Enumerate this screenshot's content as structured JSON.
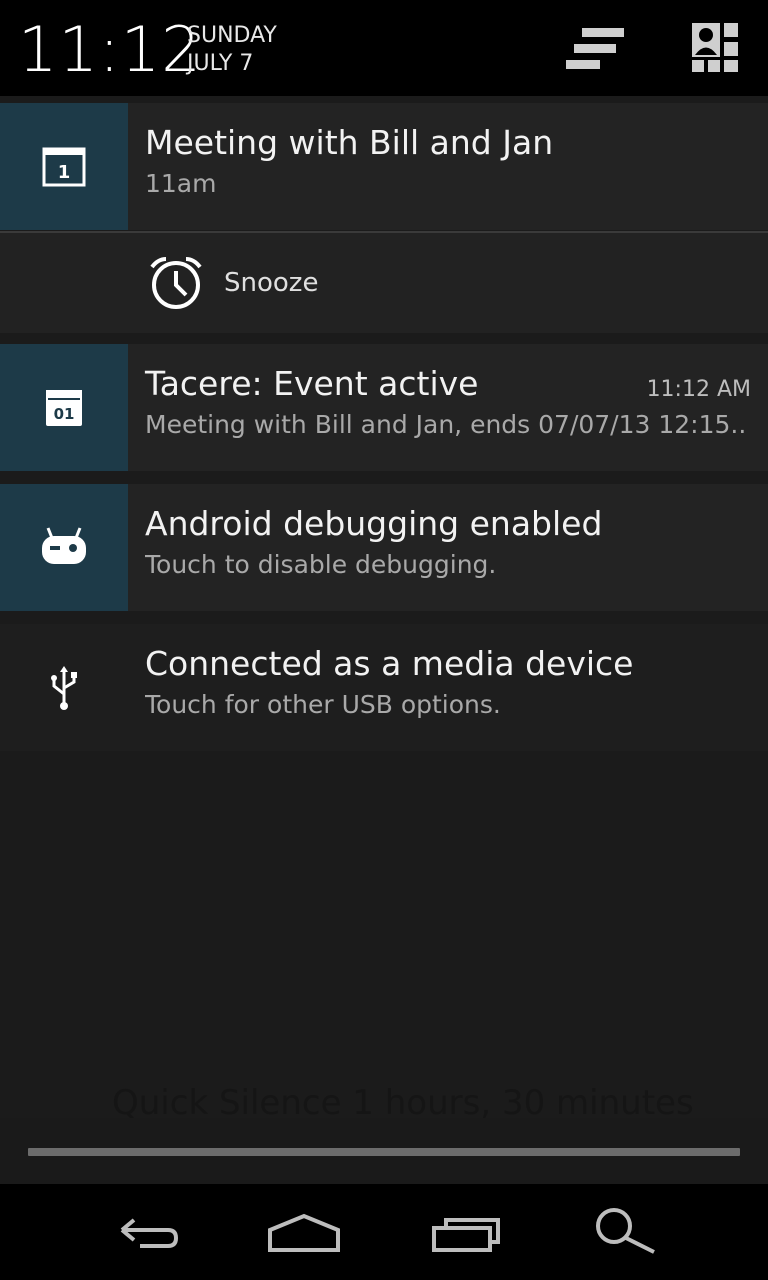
{
  "header": {
    "time": "11:12",
    "day": "SUNDAY",
    "date": "JULY 7"
  },
  "notifications": [
    {
      "title": "Meeting with Bill and Jan",
      "subtitle": "11am",
      "icon": "calendar-icon",
      "action_label": "Snooze",
      "action_icon": "alarm-clock-icon"
    },
    {
      "title": "Tacere: Event active",
      "subtitle": "Meeting with Bill and Jan, ends 07/07/13 12:15..",
      "time": "11:12 AM",
      "icon": "calendar-01-icon"
    },
    {
      "title": "Android debugging enabled",
      "subtitle": "Touch to disable debugging.",
      "icon": "cyanogen-bot-icon"
    },
    {
      "title": "Connected as a media device",
      "subtitle": "Touch for other USB options.",
      "icon": "usb-icon"
    }
  ],
  "background_text": "Quick Silence 1 hours, 30 minutes",
  "colors": {
    "icon_background": "#1d3a48",
    "panel_background": "#1b1b1b",
    "header_background": "#000000"
  }
}
